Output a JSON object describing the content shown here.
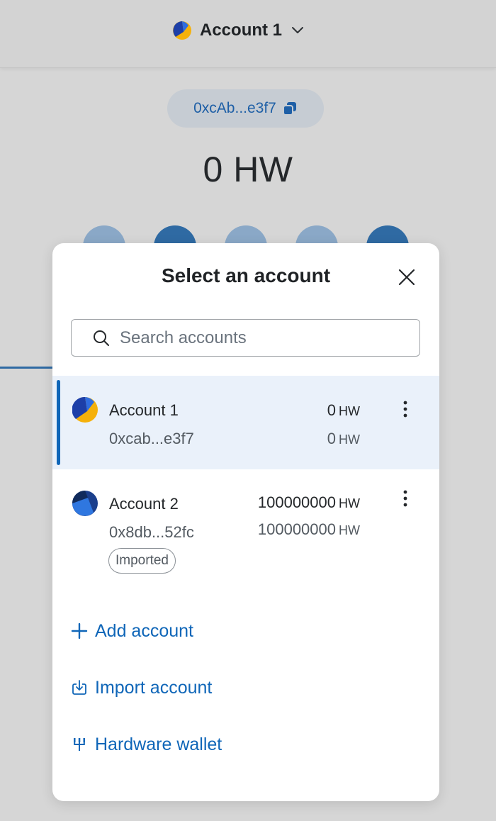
{
  "header": {
    "account_name": "Account 1",
    "address_short": "0xcAb...e3f7",
    "balance": "0 HW"
  },
  "modal": {
    "title": "Select an account",
    "search_placeholder": "Search accounts",
    "accounts": [
      {
        "name": "Account 1",
        "address": "0xcab...e3f7",
        "balance_value": "0",
        "fiat_value": "0",
        "unit": "HW",
        "selected": true,
        "badge": ""
      },
      {
        "name": "Account 2",
        "address": "0x8db...52fc",
        "balance_value": "100000000",
        "fiat_value": "100000000",
        "unit": "HW",
        "selected": false,
        "badge": "Imported"
      }
    ],
    "actions": {
      "add_account": "Add account",
      "import_account": "Import account",
      "hardware_wallet": "Hardware wallet"
    }
  },
  "colors": {
    "accent": "#0f66b8",
    "selected_row_bg": "#eaf1fa",
    "overlay_bg": "#d6d6d6"
  },
  "icons": {
    "account_picker": "chevron-down-icon",
    "copy": "copy-icon",
    "close": "close-icon",
    "search": "search-icon",
    "row_menu": "kebab-menu-icon",
    "add": "plus-icon",
    "import": "download-icon",
    "hardware": "usb-icon"
  }
}
